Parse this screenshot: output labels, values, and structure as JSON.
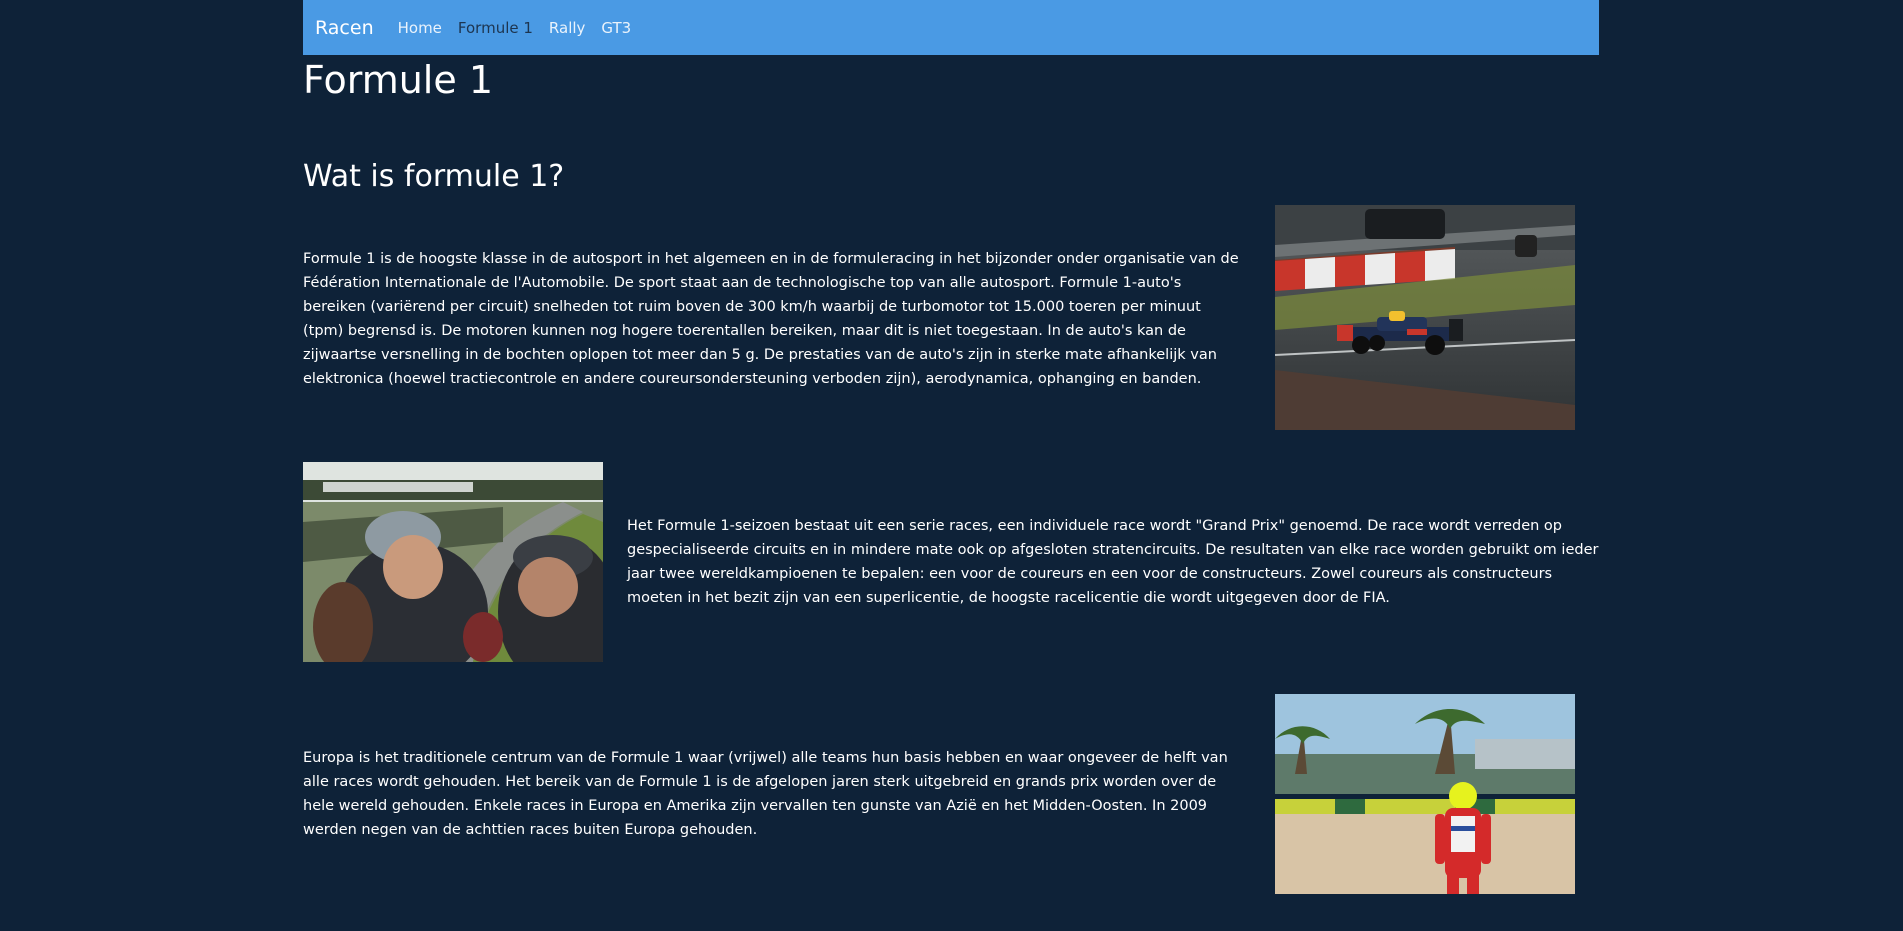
{
  "nav": {
    "brand": "Racen",
    "links": [
      {
        "label": "Home"
      },
      {
        "label": "Formule 1"
      },
      {
        "label": "Rally"
      },
      {
        "label": "GT3"
      }
    ]
  },
  "page": {
    "title": "Formule 1",
    "section_title": "Wat is formule 1?"
  },
  "content": {
    "paragraphs": [
      "Formule 1 is de hoogste klasse in de autosport in het algemeen en in de formuleracing in het bijzonder onder organisatie van de Fédération Internationale de l'Automobile. De sport staat aan de technologische top van alle autosport. Formule 1-auto's bereiken (variërend per circuit) snelheden tot ruim boven de 300 km/h waarbij de turbomotor tot 15.000 toeren per minuut (tpm) begrensd is. De motoren kunnen nog hogere toerentallen bereiken, maar dit is niet toegestaan. In de auto's kan de zijwaartse versnelling in de bochten oplopen tot meer dan 5 g. De prestaties van de auto's zijn in sterke mate afhankelijk van elektronica (hoewel tractiecontrole en andere coureursondersteuning verboden zijn), aerodynamica, ophanging en banden.",
      "Het Formule 1-seizoen bestaat uit een serie races, een individuele race wordt \"Grand Prix\" genoemd. De race wordt verreden op gespecialiseerde circuits en in mindere mate ook op afgesloten stratencircuits. De resultaten van elke race worden gebruikt om ieder jaar twee wereldkampioenen te bepalen: een voor de coureurs en een voor de constructeurs. Zowel coureurs als constructeurs moeten in het bezit zijn van een superlicentie, de hoogste racelicentie die wordt uitgegeven door de FIA.",
      "Europa is het traditionele centrum van de Formule 1 waar (vrijwel) alle teams hun basis hebben en waar ongeveer de helft van alle races wordt gehouden. Het bereik van de Formule 1 is de afgelopen jaren sterk uitgebreid en grands prix worden over de hele wereld gehouden. Enkele races in Europa en Amerika zijn vervallen ten gunste van Azië en het Midden-Oosten. In 2009 werden negen van de achttien races buiten Europa gehouden."
    ]
  },
  "colors": {
    "background": "#0e2238",
    "navbar": "#4a9ae4",
    "active_link": "#1d3550"
  }
}
